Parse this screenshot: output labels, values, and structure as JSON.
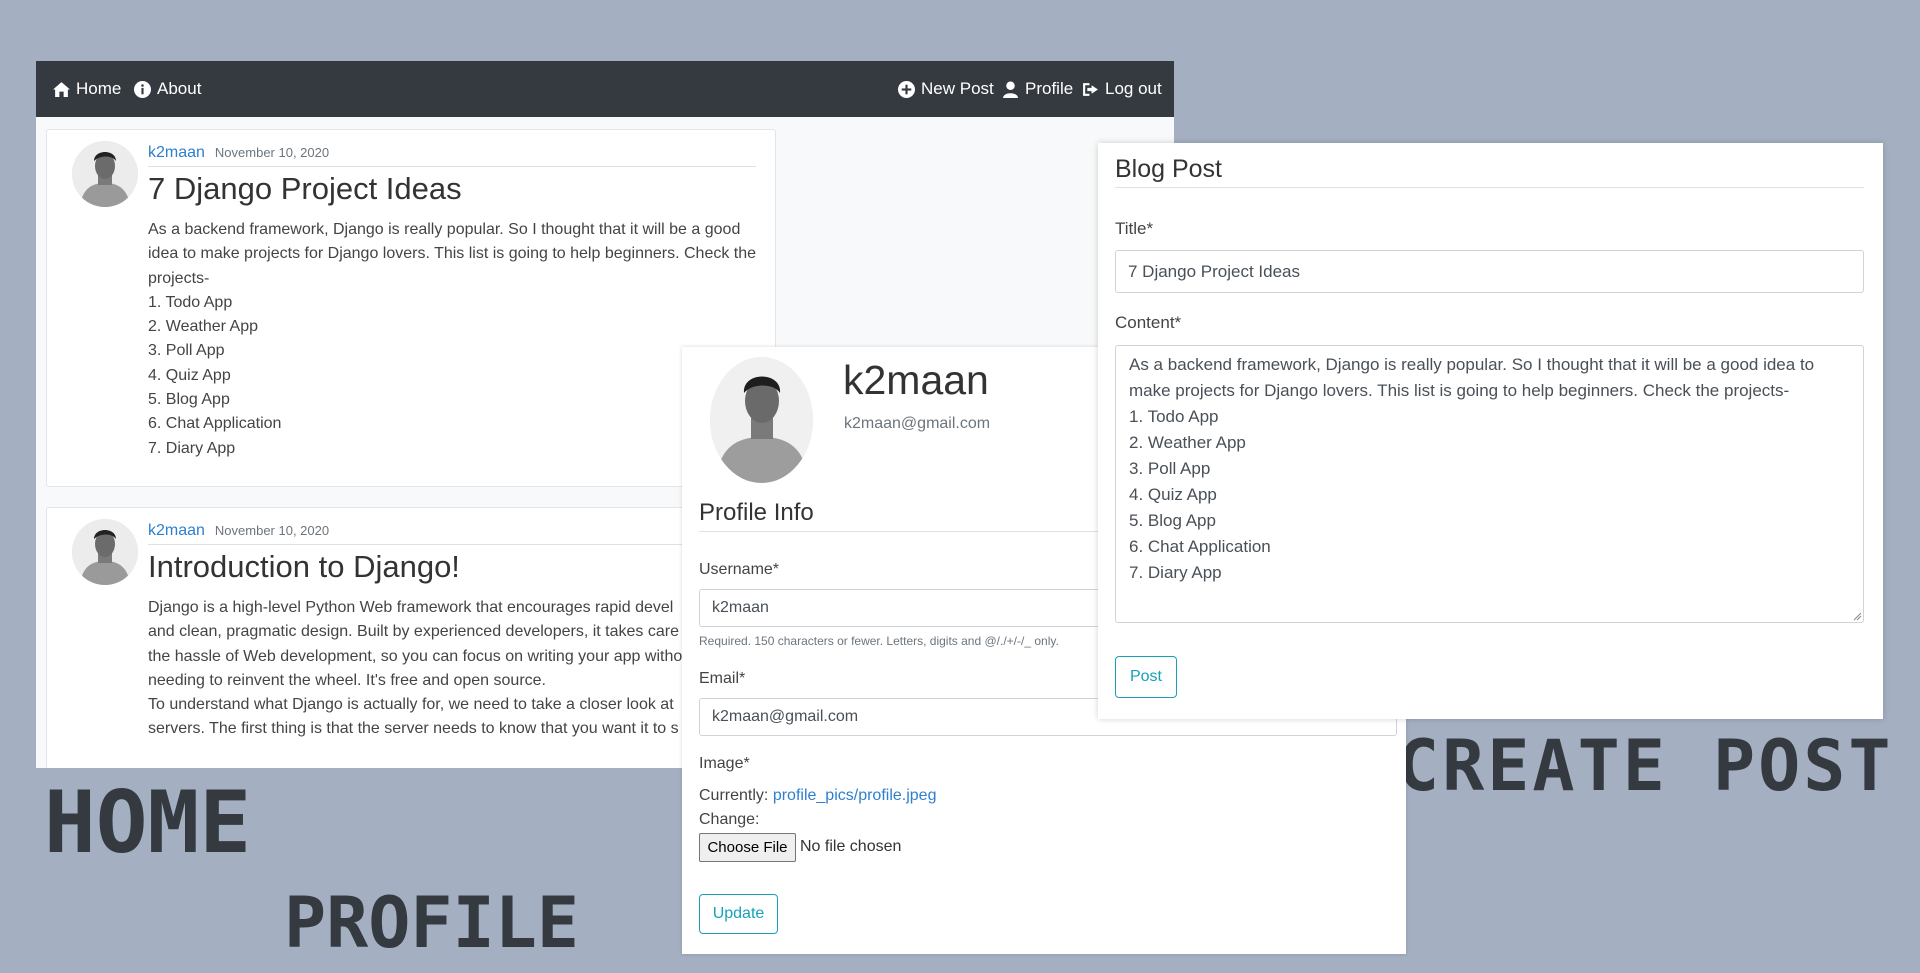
{
  "nav": {
    "home": "Home",
    "about": "About",
    "new_post": "New Post",
    "profile": "Profile",
    "logout": "Log out"
  },
  "posts": [
    {
      "author": "k2maan",
      "date": "November 10, 2020",
      "title": "7 Django Project Ideas",
      "lines": [
        "As a backend framework, Django is really popular. So I thought that it will be a good",
        "idea to make projects for Django lovers. This list is going to help beginners. Check the",
        "projects-",
        "1. Todo App",
        "2. Weather App",
        "3. Poll App",
        "4. Quiz App",
        "5. Blog App",
        "6. Chat Application",
        "7. Diary App"
      ]
    },
    {
      "author": "k2maan",
      "date": "November 10, 2020",
      "title": "Introduction to Django!",
      "lines": [
        "Django is a high-level Python Web framework that encourages rapid devel",
        "and clean, pragmatic design. Built by experienced developers, it takes care o",
        "the hassle of Web development, so you can focus on writing your app witho",
        "needing to reinvent the wheel. It's free and open source.",
        "",
        "To understand what Django is actually for, we need to take a closer look at",
        "servers. The first thing is that the server needs to know that you want it to s"
      ]
    }
  ],
  "labels": {
    "home": "HOME",
    "profile": "PROFILE",
    "create_post": "CREATE POST"
  },
  "profile": {
    "username": "k2maan",
    "email": "k2maan@gmail.com",
    "section_title": "Profile Info",
    "username_label": "Username*",
    "username_value": "k2maan",
    "username_help": "Required. 150 characters or fewer. Letters, digits and @/./+/-/_ only.",
    "email_label": "Email*",
    "email_value": "k2maan@gmail.com",
    "image_label": "Image*",
    "currently_label": "Currently:",
    "current_file": "profile_pics/profile.jpeg",
    "change_label": "Change:",
    "choose_file": "Choose File",
    "no_file": "No file chosen",
    "update_button": "Update"
  },
  "create": {
    "heading": "Blog Post",
    "title_label": "Title*",
    "title_value": "7 Django Project Ideas",
    "content_label": "Content*",
    "content_lines": [
      "As a backend framework, Django is really popular. So I thought that it will be a good idea to",
      "make projects for Django lovers. This list is going to help beginners. Check the projects-",
      "1. Todo App",
      "2. Weather App",
      "3. Poll App",
      "4. Quiz App",
      "5. Blog App",
      "6. Chat Application",
      "7. Diary App"
    ],
    "post_button": "Post"
  },
  "colors": {
    "page_bg": "#a4b0c2",
    "navbar": "#343a40",
    "link": "#2d7fd0",
    "accent_outline": "#17a2b8"
  },
  "icons": [
    "home-icon",
    "info-icon",
    "plus-circle-icon",
    "user-icon",
    "sign-out-icon"
  ]
}
